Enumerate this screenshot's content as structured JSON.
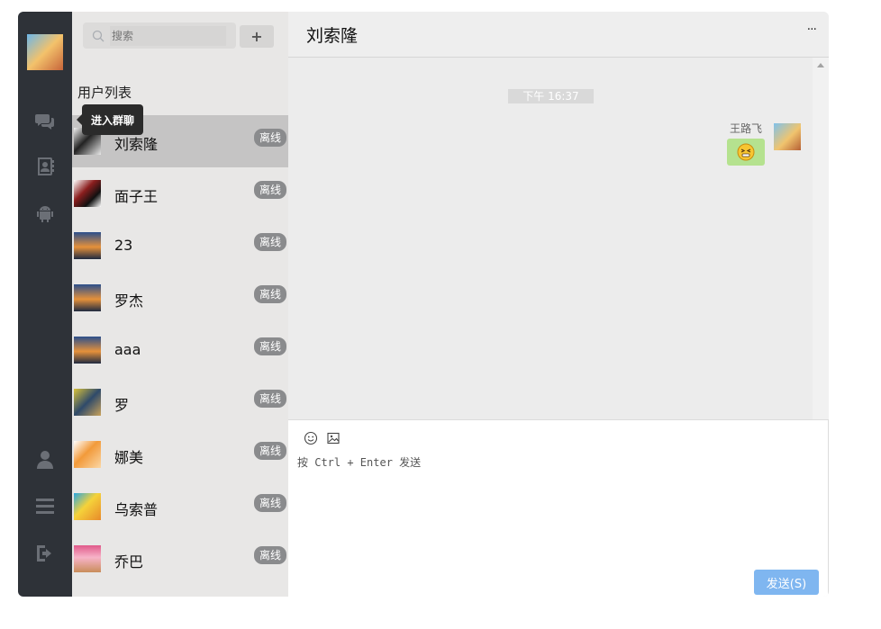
{
  "sidebar": {
    "icons": [
      "chat-icon",
      "contacts-icon",
      "android-icon",
      "profile-icon",
      "menu-icon",
      "logout-icon"
    ]
  },
  "search": {
    "placeholder": "搜索",
    "value": ""
  },
  "add_button": "+",
  "user_list": {
    "title": "用户列表",
    "tooltip": "进入群聊",
    "users": [
      {
        "name": "刘索隆",
        "status": "离线"
      },
      {
        "name": "面子王",
        "status": "离线"
      },
      {
        "name": "23",
        "status": "离线"
      },
      {
        "name": "罗杰",
        "status": "离线"
      },
      {
        "name": "aaa",
        "status": "离线"
      },
      {
        "name": "罗",
        "status": "离线"
      },
      {
        "name": "娜美",
        "status": "离线"
      },
      {
        "name": "乌索普",
        "status": "离线"
      },
      {
        "name": "乔巴",
        "status": "离线"
      }
    ]
  },
  "chat": {
    "title": "刘索隆",
    "more": "···",
    "timestamp": "下午 16:37",
    "message": {
      "sender": "王路飞",
      "content": "sticker-emoji"
    },
    "hint": "按 Ctrl + Enter 发送",
    "send": "发送(S)"
  },
  "colors": {
    "rail": "#2e3238",
    "send": "#7fb6f0",
    "bubble": "#b5e28f",
    "status": "#8a8b8d"
  }
}
